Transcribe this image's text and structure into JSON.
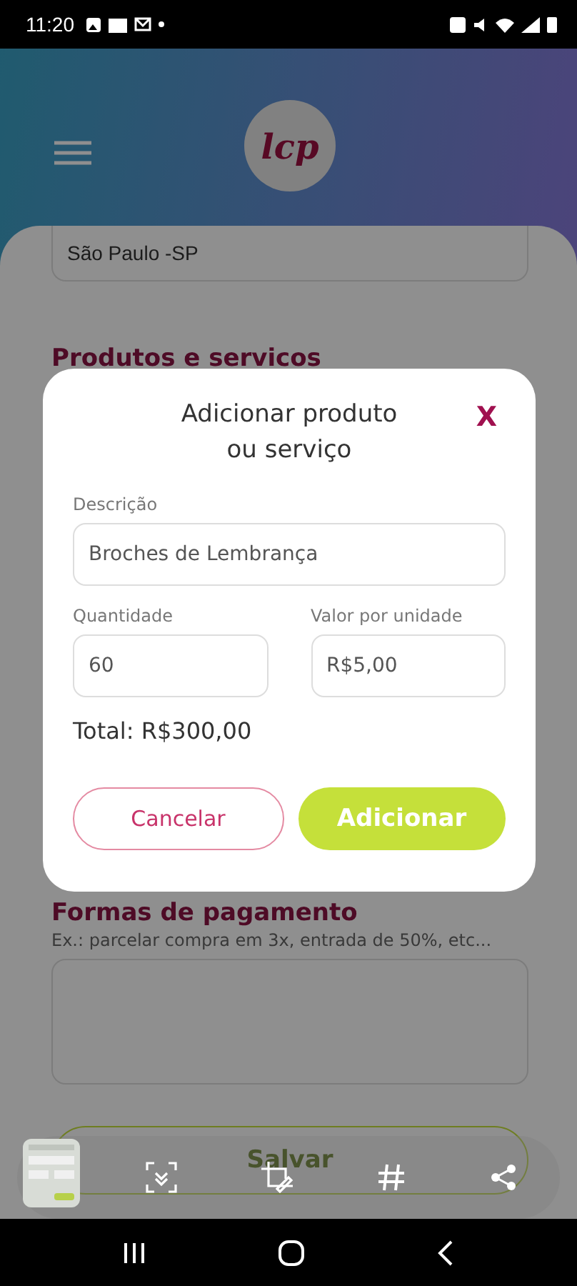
{
  "status_bar": {
    "time": "11:20"
  },
  "header": {
    "logo": "lcp"
  },
  "form": {
    "city_value": "São Paulo -SP",
    "products_heading": "Produtos e servicos",
    "payment_heading": "Formas de pagamento",
    "payment_hint": "Ex.: parcelar compra em 3x, entrada de 50%, etc...",
    "save_button": "Salvar"
  },
  "dialog": {
    "title_lines": [
      "Adicionar produto",
      "ou serviço"
    ],
    "close": "X",
    "fields": [
      {
        "label": "Descrição",
        "value": "Broches de Lembrança"
      },
      {
        "label": "Quantidade",
        "value": "60"
      },
      {
        "label": "Valor por unidade",
        "value": "R$5,00"
      }
    ],
    "total": "Total: R$300,00",
    "buttons": [
      {
        "label": "Cancelar",
        "kind": "outline"
      },
      {
        "label": "Adicionar",
        "kind": "primary"
      }
    ]
  }
}
